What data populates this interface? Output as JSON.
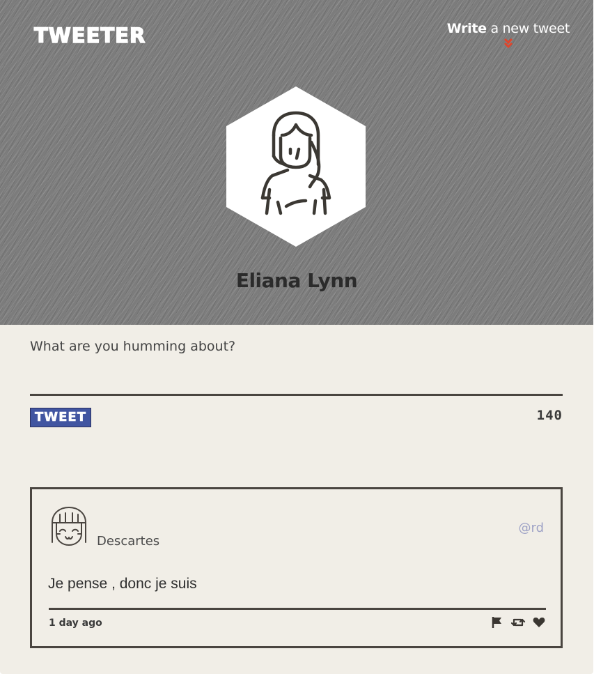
{
  "header": {
    "logo": "TWEETER",
    "compose_toggle": {
      "bold": "Write",
      "rest": " a new tweet",
      "icon": "double-chevron-down-icon",
      "icon_color": "#e0452c"
    },
    "user_name": "Eliana Lynn",
    "avatar_icon": "girl-avatar-icon"
  },
  "compose": {
    "placeholder": "What are you humming about?",
    "button_label": "TWEET",
    "counter": "140",
    "button_color": "#4155a1"
  },
  "tweets": [
    {
      "avatar_icon": "smiling-face-avatar-icon",
      "name": "Descartes",
      "handle": "@rd",
      "text": "Je pense , donc je suis",
      "time": "1 day ago",
      "actions": [
        "flag-icon",
        "retweet-icon",
        "heart-icon"
      ]
    }
  ]
}
